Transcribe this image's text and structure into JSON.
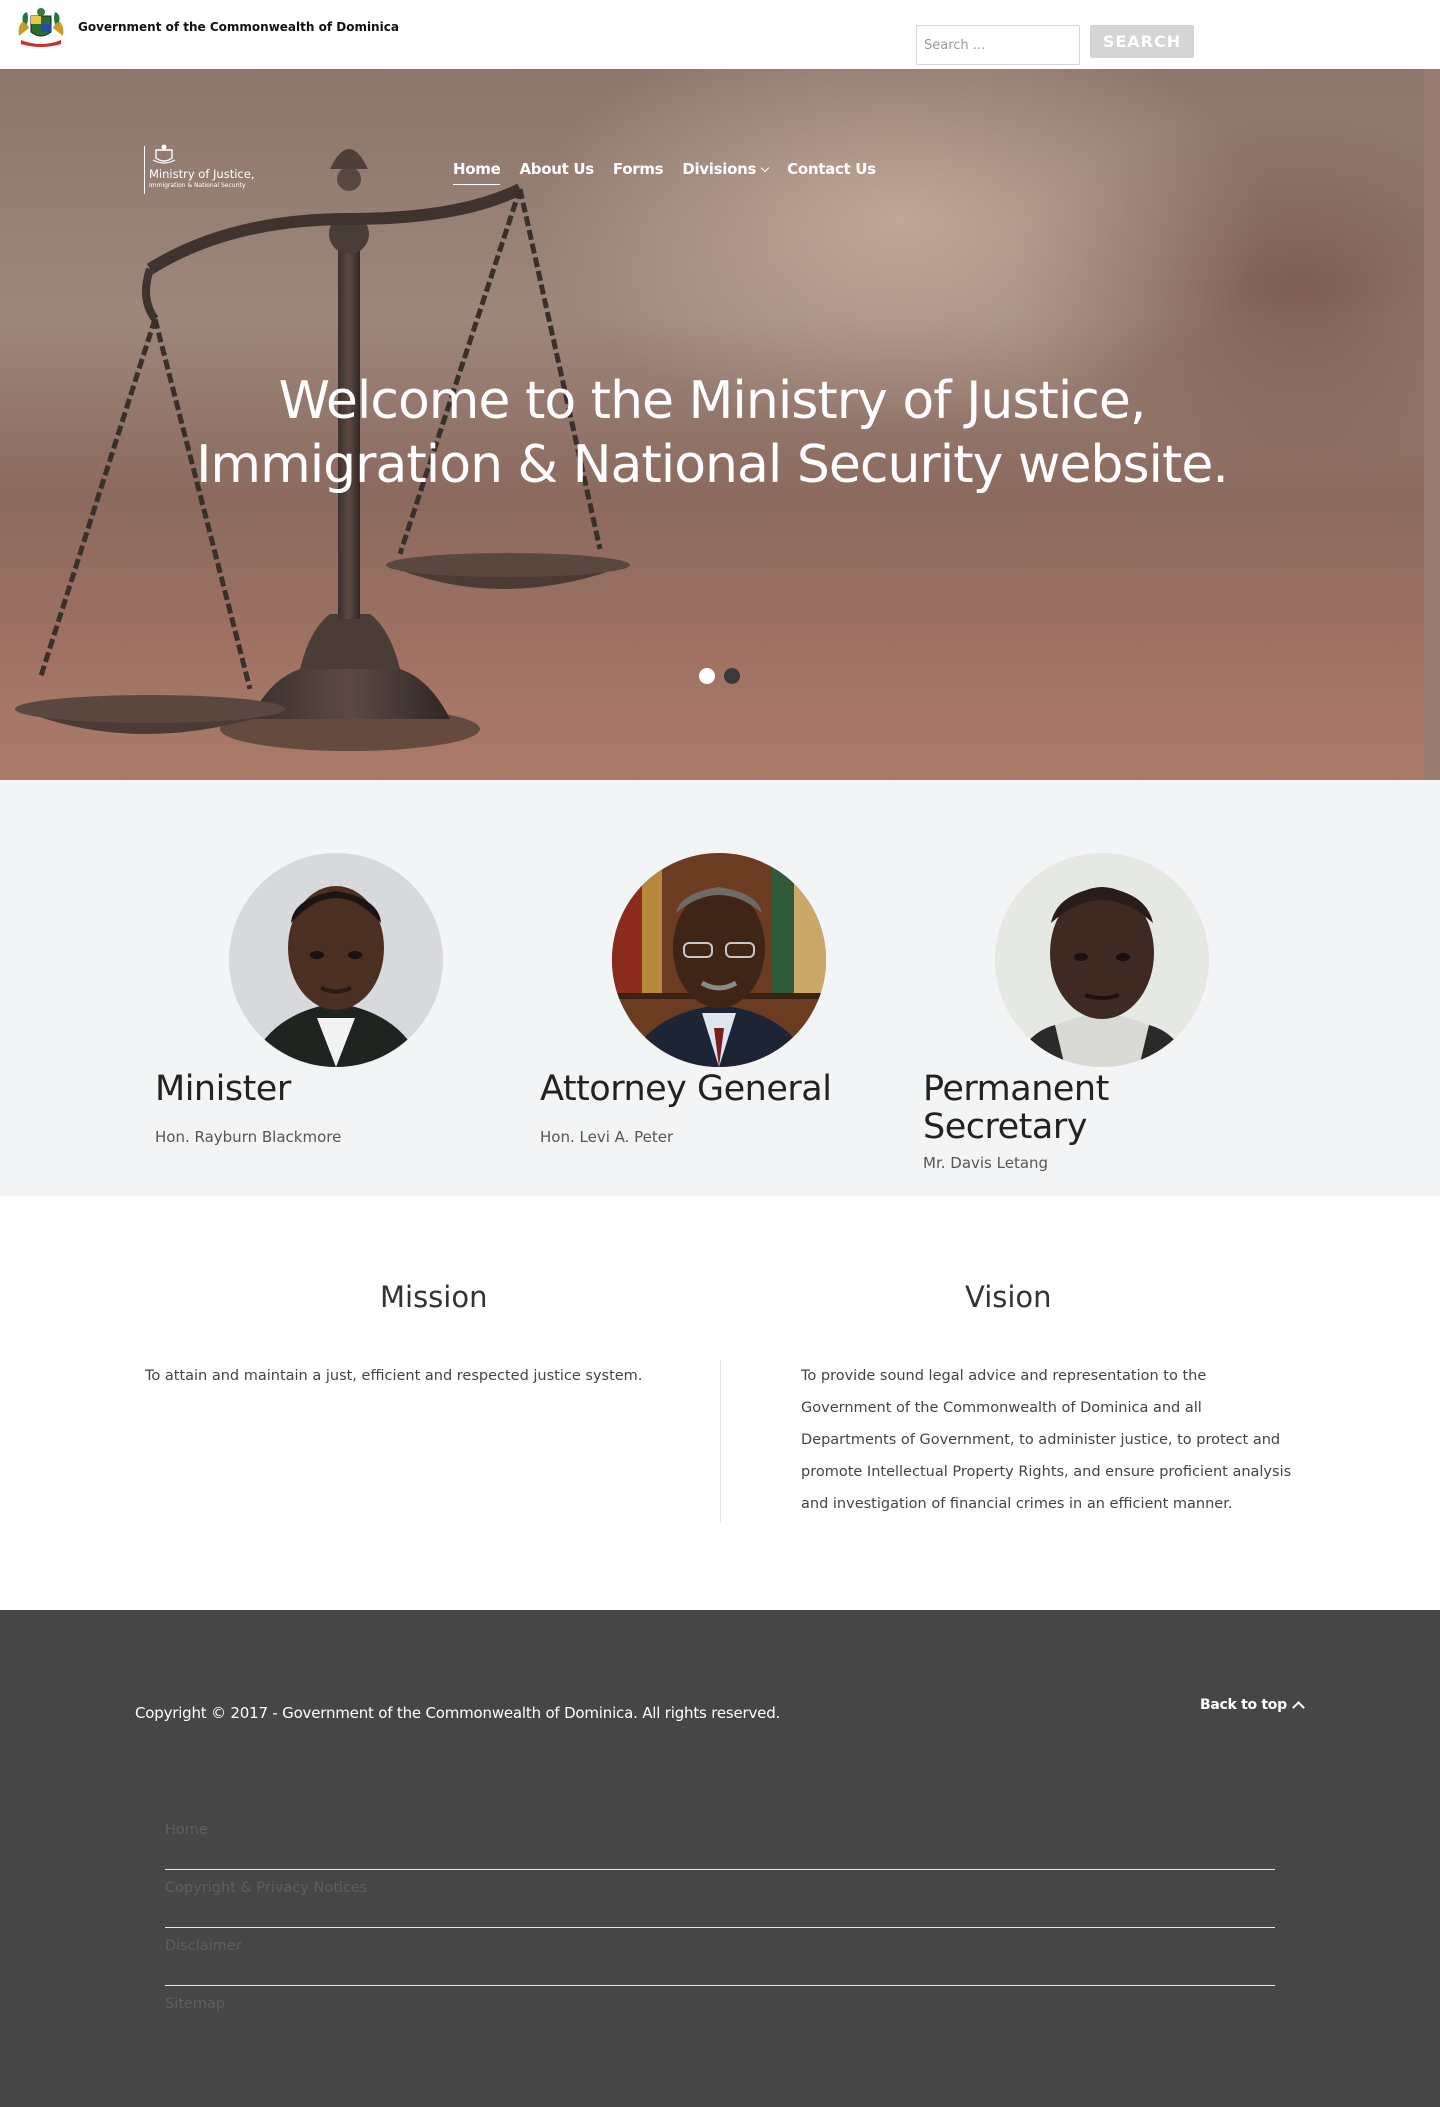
{
  "gov_bar": {
    "title": "Government of the Commonwealth of Dominica",
    "search_placeholder": "Search ...",
    "search_button": "SEARCH"
  },
  "ministry_logo": {
    "name": "Ministry of Justice,",
    "subtitle": "Immigration & National Security"
  },
  "nav": {
    "items": [
      {
        "label": "Home",
        "active": true
      },
      {
        "label": "About Us"
      },
      {
        "label": "Forms"
      },
      {
        "label": "Divisions",
        "has_dropdown": true
      },
      {
        "label": "Contact Us"
      }
    ]
  },
  "hero": {
    "heading_line1": "Welcome to the Ministry of Justice,",
    "heading_line2": "Immigration & National Security website.",
    "slides": 2,
    "active_slide": 1
  },
  "officials": [
    {
      "title": "Minister",
      "name": "Hon. Rayburn Blackmore"
    },
    {
      "title": "Attorney General",
      "name": "Hon. Levi A. Peter"
    },
    {
      "title_line1": "Permanent",
      "title_line2": "Secretary",
      "name": "Mr. Davis Letang"
    }
  ],
  "mission": {
    "heading": "Mission",
    "text": "To attain and maintain a just, efficient and respected justice system."
  },
  "vision": {
    "heading": "Vision",
    "lines": [
      "To provide sound legal advice and representation to the",
      "Government of the Commonwealth of Dominica and all",
      "Departments of Government, to administer justice, to protect and",
      "promote Intellectual Property Rights, and ensure proficient analysis",
      "and investigation of financial crimes in an efficient manner."
    ]
  },
  "footer": {
    "copyright": "Copyright © 2017 - Government of the Commonwealth of Dominica. All rights reserved.",
    "back_to_top": "Back to top",
    "links": [
      "Home",
      "Copyright & Privacy Notices",
      "Disclaimer",
      "Sitemap"
    ]
  },
  "colors": {
    "footer_bg": "#464646",
    "section_bg": "#f3f4f5",
    "search_button_bg": "#d5d5d5"
  }
}
